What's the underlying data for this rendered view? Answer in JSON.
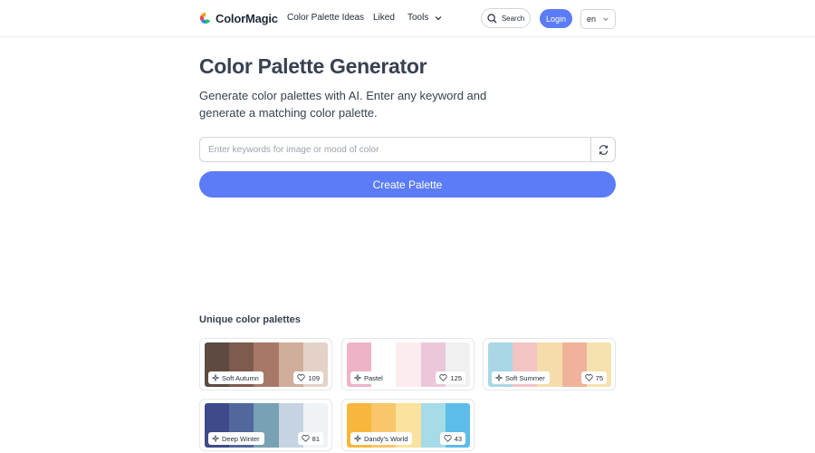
{
  "brand": {
    "name": "ColorMagic"
  },
  "nav": {
    "items": [
      "Color Palette Ideas",
      "Liked",
      "Tools"
    ],
    "search_label": "Search",
    "login_label": "Login",
    "language": "en"
  },
  "hero": {
    "title": "Color Palette Generator",
    "subtitle": "Generate color palettes with AI. Enter any keyword and generate a matching color palette.",
    "input_value": "",
    "input_placeholder": "Enter keywords for image or mood of color",
    "create_label": "Create Palette"
  },
  "palettes": {
    "heading": "Unique color palettes",
    "items": [
      {
        "name": "Soft Autumn",
        "likes": "109",
        "colors": [
          "#5e4a41",
          "#7e5a4f",
          "#a77867",
          "#d1ad9c",
          "#e4d2c8"
        ]
      },
      {
        "name": "Pastel",
        "likes": "125",
        "colors": [
          "#eeb3c6",
          "#ffffff",
          "#fdeced",
          "#ecc7d9",
          "#f0f0f1"
        ]
      },
      {
        "name": "Soft Summer",
        "likes": "75",
        "colors": [
          "#a9d7e6",
          "#f2c4c4",
          "#f5ddab",
          "#f0b29b",
          "#f5e1ae"
        ]
      },
      {
        "name": "Deep Winter",
        "likes": "81",
        "colors": [
          "#3e4a8a",
          "#52689c",
          "#78a1b3",
          "#c5d3e2",
          "#f0f3f6"
        ]
      },
      {
        "name": "Dandy's World",
        "likes": "43",
        "colors": [
          "#f6b73c",
          "#f9c66b",
          "#fbe29e",
          "#a6dbe8",
          "#5cbde9"
        ]
      }
    ]
  },
  "colors": {
    "accent": "#5b7cf6",
    "text": "#374151",
    "border": "#d1d5db"
  }
}
